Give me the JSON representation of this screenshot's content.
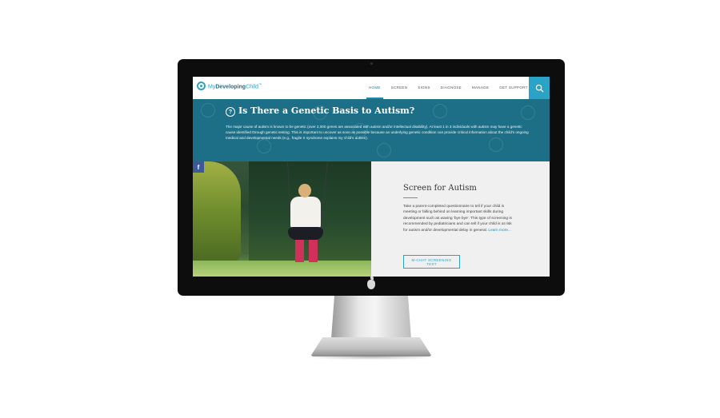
{
  "nav": {
    "logo_part1": "My",
    "logo_part2": "Developing",
    "logo_part3": "Child",
    "logo_tm": "™",
    "items": [
      {
        "label": "HOME"
      },
      {
        "label": "SCREEN"
      },
      {
        "label": "SIGNS"
      },
      {
        "label": "DIAGNOSE"
      },
      {
        "label": "MANAGE"
      },
      {
        "label": "GET SUPPORT"
      }
    ],
    "active_item": "HOME",
    "search_icon": "search-icon"
  },
  "banner": {
    "title": "Is There a Genetic Basis to Autism?",
    "body": "The major cause of autism is known to be genetic (over 2,000 genes are associated with autism and/or intellectual disability). At least 1 in 3 individuals with autism may have a genetic cause identified through genetic testing. This is important to uncover as soon as possible because an underlying genetic condition can provide critical information about the child's ongoing medical and developmental needs (e.g., fragile X syndrome explains my child's autism).",
    "icon": "question-bubble-icon"
  },
  "photo": {
    "alt_description": "child-on-swing-photo",
    "share_label": "f"
  },
  "panel": {
    "title": "Screen for Autism",
    "body": "Take a parent-completed questionnaire to tell if your child is meeting or falling behind on learning important skills during development such as waving 'bye bye'. This type of screening is recommended by pediatricians and can tell if your child is at risk for autism and/or developmental delay in general.",
    "learn_more": "Learn more...",
    "button_label": "M-CHAT SCREENING TEST"
  },
  "colors": {
    "accent": "#2aa3c6",
    "banner_bg": "#1c6f86",
    "panel_bg": "#f0f0f0",
    "facebook": "#3b5998"
  }
}
